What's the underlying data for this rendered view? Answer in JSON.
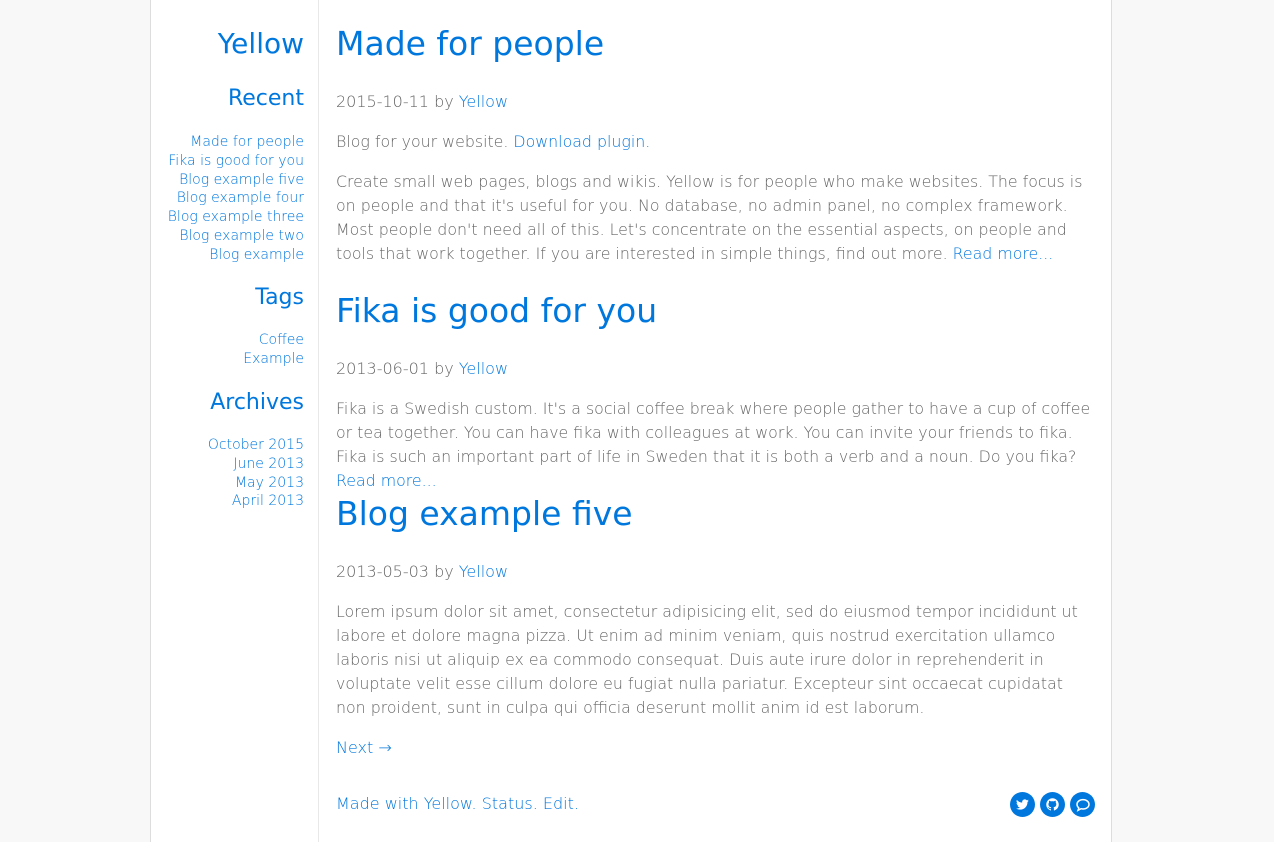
{
  "site": {
    "title": "Yellow"
  },
  "sidebar": {
    "recent_heading": "Recent",
    "recent": [
      "Made for people",
      "Fika is good for you",
      "Blog example five",
      "Blog example four",
      "Blog example three",
      "Blog example two",
      "Blog example"
    ],
    "tags_heading": "Tags",
    "tags": [
      "Coffee",
      "Example"
    ],
    "archives_heading": "Archives",
    "archives": [
      "October 2015",
      "June 2013",
      "May 2013",
      "April 2013"
    ]
  },
  "posts": [
    {
      "title": "Made for people",
      "date": "2015-10-11",
      "by": " by ",
      "author": "Yellow",
      "intro_text": "Blog for your website. ",
      "intro_link": "Download plugin.",
      "body": "Create small web pages, blogs and wikis. Yellow is for people who make websites. The focus is on people and that it's useful for you. No database, no admin panel, no complex framework. Most people don't need all of this. Let's concentrate on the essential aspects, on people and tools that work together. If you are interested in simple things, find out more. ",
      "read_more": "Read more..."
    },
    {
      "title": "Fika is good for you",
      "date": "2013-06-01",
      "by": " by ",
      "author": "Yellow",
      "body": "Fika is a Swedish custom. It's a social coffee break where people gather to have a cup of coffee or tea together. You can have fika with colleagues at work. You can invite your friends to fika. Fika is such an important part of life in Sweden that it is both a verb and a noun. Do you fika? ",
      "read_more": "Read more..."
    },
    {
      "title": "Blog example five",
      "date": "2013-05-03",
      "by": " by ",
      "author": "Yellow",
      "body": "Lorem ipsum dolor sit amet, consectetur adipisicing elit, sed do eiusmod tempor incididunt ut labore et dolore magna pizza. Ut enim ad minim veniam, quis nostrud exercitation ullamco laboris nisi ut aliquip ex ea commodo consequat. Duis aute irure dolor in reprehenderit in voluptate velit esse cillum dolore eu fugiat nulla pariatur. Excepteur sint occaecat cupidatat non proident, sunt in culpa qui officia deserunt mollit anim id est laborum."
    }
  ],
  "pagination": {
    "next": "Next →"
  },
  "footer": {
    "made_with": "Made with Yellow.",
    "status": "Status.",
    "edit": "Edit.",
    "socials": [
      "twitter-icon",
      "github-icon",
      "chat-icon"
    ]
  },
  "colors": {
    "accent": "#0077dd",
    "text": "#666666",
    "background": "#f8f8f8"
  }
}
